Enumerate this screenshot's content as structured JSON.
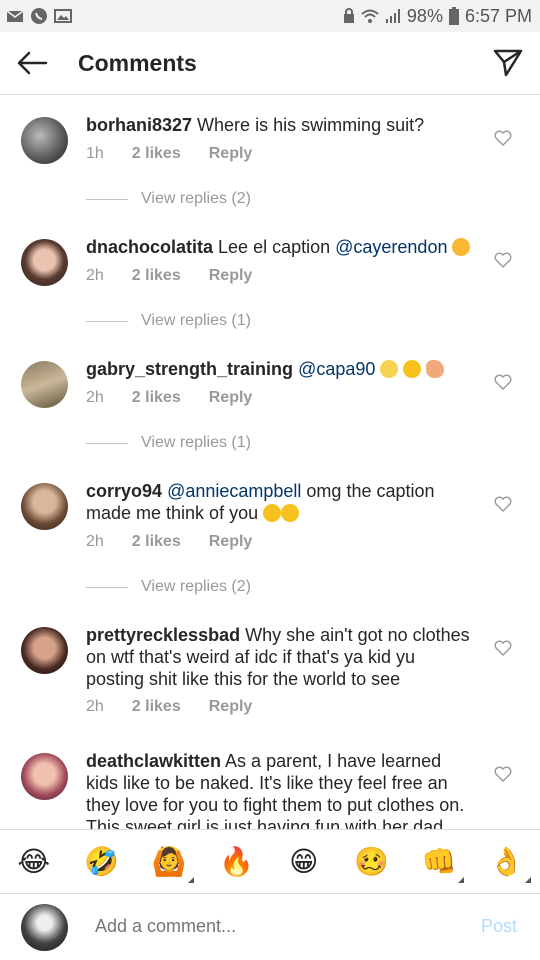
{
  "status_bar": {
    "battery": "98%",
    "time": "6:57 PM"
  },
  "header": {
    "title": "Comments"
  },
  "comments": [
    {
      "username": "borhani8327",
      "text": " Where is his swimming suit?",
      "time": "1h",
      "likes": "2 likes",
      "reply": "Reply",
      "view_replies": "View replies (2)"
    },
    {
      "username": "dnachocolatita",
      "text": " Lee el caption ",
      "mention": "@cayerendon",
      "time": "2h",
      "likes": "2 likes",
      "reply": "Reply",
      "view_replies": "View replies (1)"
    },
    {
      "username": "gabry_strength_training",
      "mention": "@capa90",
      "time": "2h",
      "likes": "2 likes",
      "reply": "Reply",
      "view_replies": "View replies (1)"
    },
    {
      "username": "corryo94",
      "mention": "@anniecampbell",
      "text": " omg the caption made me think of you",
      "time": "2h",
      "likes": "2 likes",
      "reply": "Reply",
      "view_replies": "View replies (2)"
    },
    {
      "username": "prettyrecklessbad",
      "text": " Why she ain't got no clothes on wtf that's weird af idc if that's ya kid yu posting shit like this for the world to see",
      "time": "2h",
      "likes": "2 likes",
      "reply": "Reply"
    },
    {
      "username": "deathclawkitten",
      "text": " As a parent, I have learned kids like to be naked. It's like they feel free an they love for you to fight them to put clothes on. This sweet girl is just having fun with her dad"
    }
  ],
  "emoji_bar": [
    "😂",
    "🤣",
    "🙆",
    "🔥",
    "😁",
    "🥴",
    "👊",
    "👌"
  ],
  "compose": {
    "placeholder": "Add a comment...",
    "post_label": "Post"
  },
  "colors": {
    "mention": "#003569",
    "post_disabled": "#b3dbff",
    "meta_gray": "#999999"
  }
}
